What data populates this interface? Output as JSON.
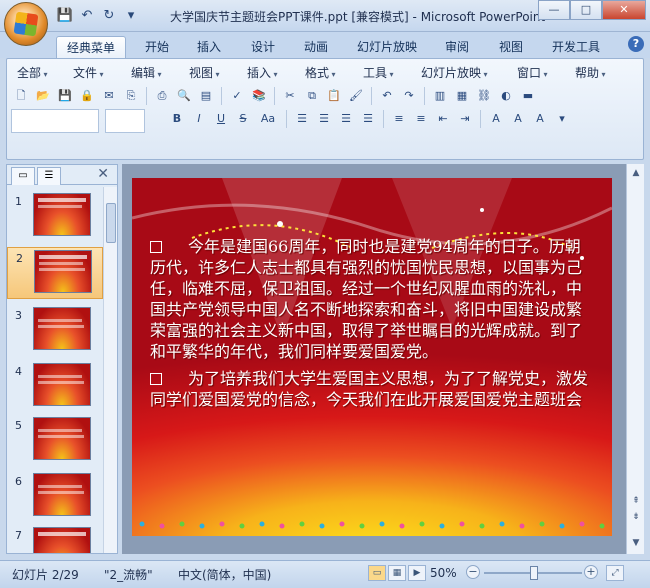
{
  "window": {
    "title": "大学国庆节主题班会PPT课件.ppt [兼容模式] - Microsoft PowerPoint",
    "controls": {
      "minimize": "—",
      "maximize": "□",
      "close": "✕"
    }
  },
  "quick_access": {
    "save": "💾",
    "undo": "↶",
    "redo": "↻",
    "more": "▾"
  },
  "ribbon_tabs": [
    "经典菜单",
    "开始",
    "插入",
    "设计",
    "动画",
    "幻灯片放映",
    "审阅",
    "视图",
    "开发工具"
  ],
  "help_icon": "?",
  "classic_menu": [
    "全部",
    "文件",
    "编辑",
    "视图",
    "插入",
    "格式",
    "工具",
    "幻灯片放映",
    "窗口",
    "帮助"
  ],
  "toolbar_glyphs": {
    "bold": "B",
    "italic": "I",
    "underline": "U",
    "strike": "S",
    "font_case": "Aa"
  },
  "nav_pane": {
    "thumbnails": [
      {
        "num": "1",
        "label": "国庆节主题班会"
      },
      {
        "num": "2",
        "label": ""
      },
      {
        "num": "3",
        "label": ""
      },
      {
        "num": "4",
        "label": ""
      },
      {
        "num": "5",
        "label": ""
      },
      {
        "num": "6",
        "label": ""
      },
      {
        "num": "7",
        "label": "国庆节庆"
      }
    ],
    "selected_index": 1
  },
  "slide": {
    "paragraphs": [
      "今年是建国66周年，同时也是建党94周年的日子。历朝历代，许多仁人志士都具有强烈的忧国忧民思想，以国事为己任，临难不屈，保卫祖国。经过一个世纪风腥血雨的洗礼，中国共产党领导中国人名不断地探索和奋斗，将旧中国建设成繁荣富强的社会主义新中国，取得了举世瞩目的光辉成就。到了和平繁华的年代，我们同样要爱国爱党。",
      "为了培养我们大学生爱国主义思想，为了了解党史，激发同学们爱国爱党的信念，今天我们在此开展爱国爱党主题班会"
    ]
  },
  "status": {
    "slide_info": "幻灯片 2/29",
    "theme": "\"2_流畅\"",
    "language": "中文(简体，中国)",
    "zoom": "50%"
  }
}
